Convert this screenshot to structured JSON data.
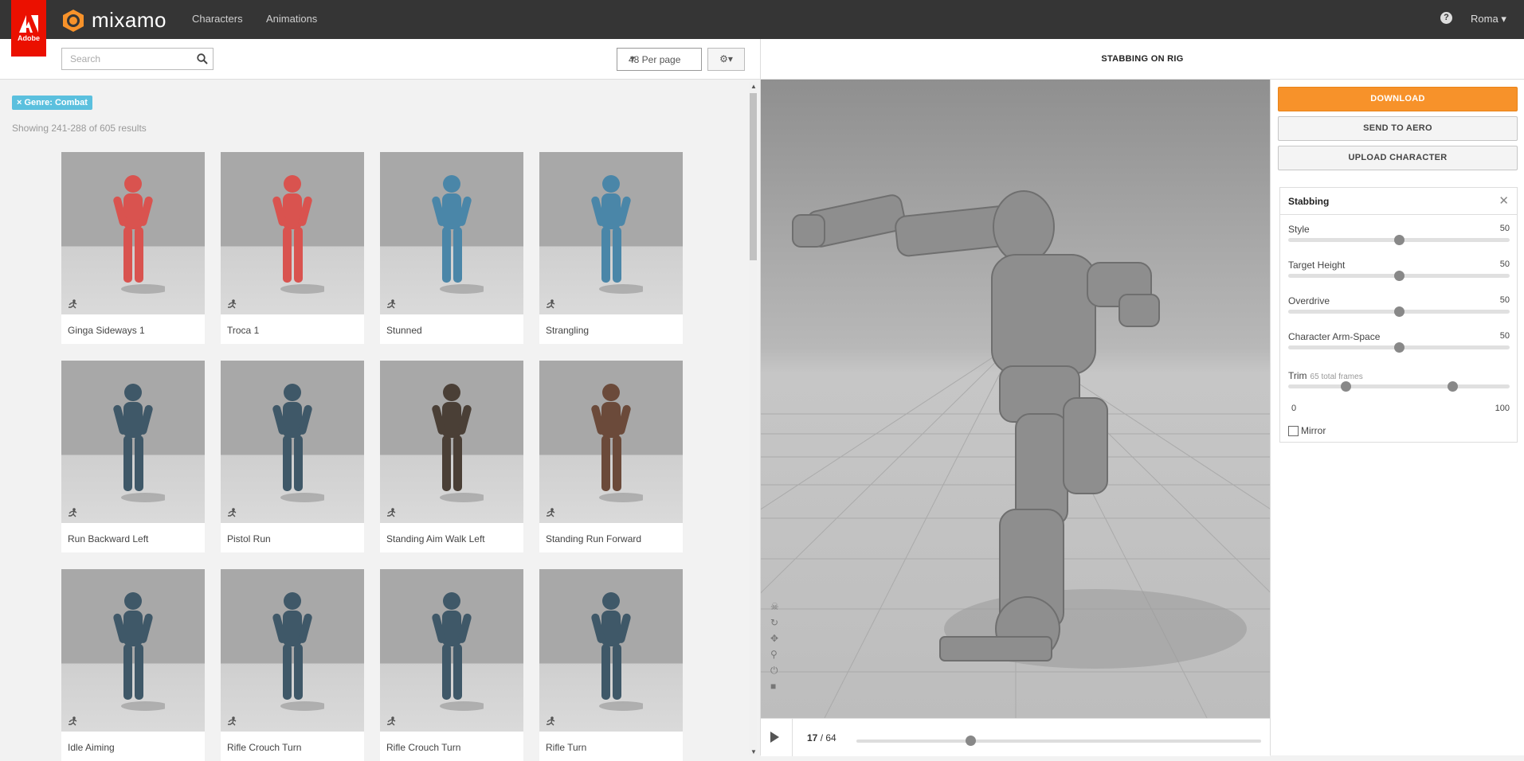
{
  "header": {
    "adobe_label": "Adobe",
    "brand": "mixamo",
    "nav": [
      "Characters",
      "Animations"
    ],
    "help": "?",
    "user": "Roma"
  },
  "toolbar": {
    "search_placeholder": "Search",
    "per_page": "48 Per page"
  },
  "filter": {
    "tag": "× Genre: Combat",
    "results": "Showing 241-288 of 605 results"
  },
  "grid": [
    {
      "label": "Ginga Sideways 1",
      "color": "#d9534f"
    },
    {
      "label": "Troca 1",
      "color": "#d9534f"
    },
    {
      "label": "Stunned",
      "color": "#4a86a8"
    },
    {
      "label": "Strangling",
      "color": "#4a86a8"
    },
    {
      "label": "Run Backward Left",
      "color": "#3f5868"
    },
    {
      "label": "Pistol Run",
      "color": "#3f5868"
    },
    {
      "label": "Standing Aim Walk Left",
      "color": "#4a3f36"
    },
    {
      "label": "Standing Run Forward",
      "color": "#6b4a3a"
    },
    {
      "label": "Idle Aiming",
      "color": "#3f5868"
    },
    {
      "label": "Rifle Crouch Turn",
      "color": "#3f5868"
    },
    {
      "label": "Rifle Crouch Turn",
      "color": "#3f5868"
    },
    {
      "label": "Rifle Turn",
      "color": "#3f5868"
    }
  ],
  "preview": {
    "title": "STABBING ON RIG",
    "frame_current": "17",
    "frame_total": "/ 64",
    "playhead_fraction": 0.27
  },
  "side": {
    "download": "DOWNLOAD",
    "send": "SEND TO AERO",
    "upload": "UPLOAD CHARACTER",
    "panel_title": "Stabbing",
    "close": "✕",
    "params": [
      {
        "label": "Style",
        "value": "50",
        "level": 0.5
      },
      {
        "label": "Target Height",
        "value": "50",
        "level": 0.5
      },
      {
        "label": "Overdrive",
        "value": "50",
        "level": 0.5
      },
      {
        "label": "Character Arm-Space",
        "value": "50",
        "level": 0.5
      }
    ],
    "trim": {
      "label": "Trim",
      "note": "65 total frames",
      "min": "0",
      "max": "100",
      "start": 0.26,
      "end": 0.74
    },
    "mirror": "Mirror"
  }
}
